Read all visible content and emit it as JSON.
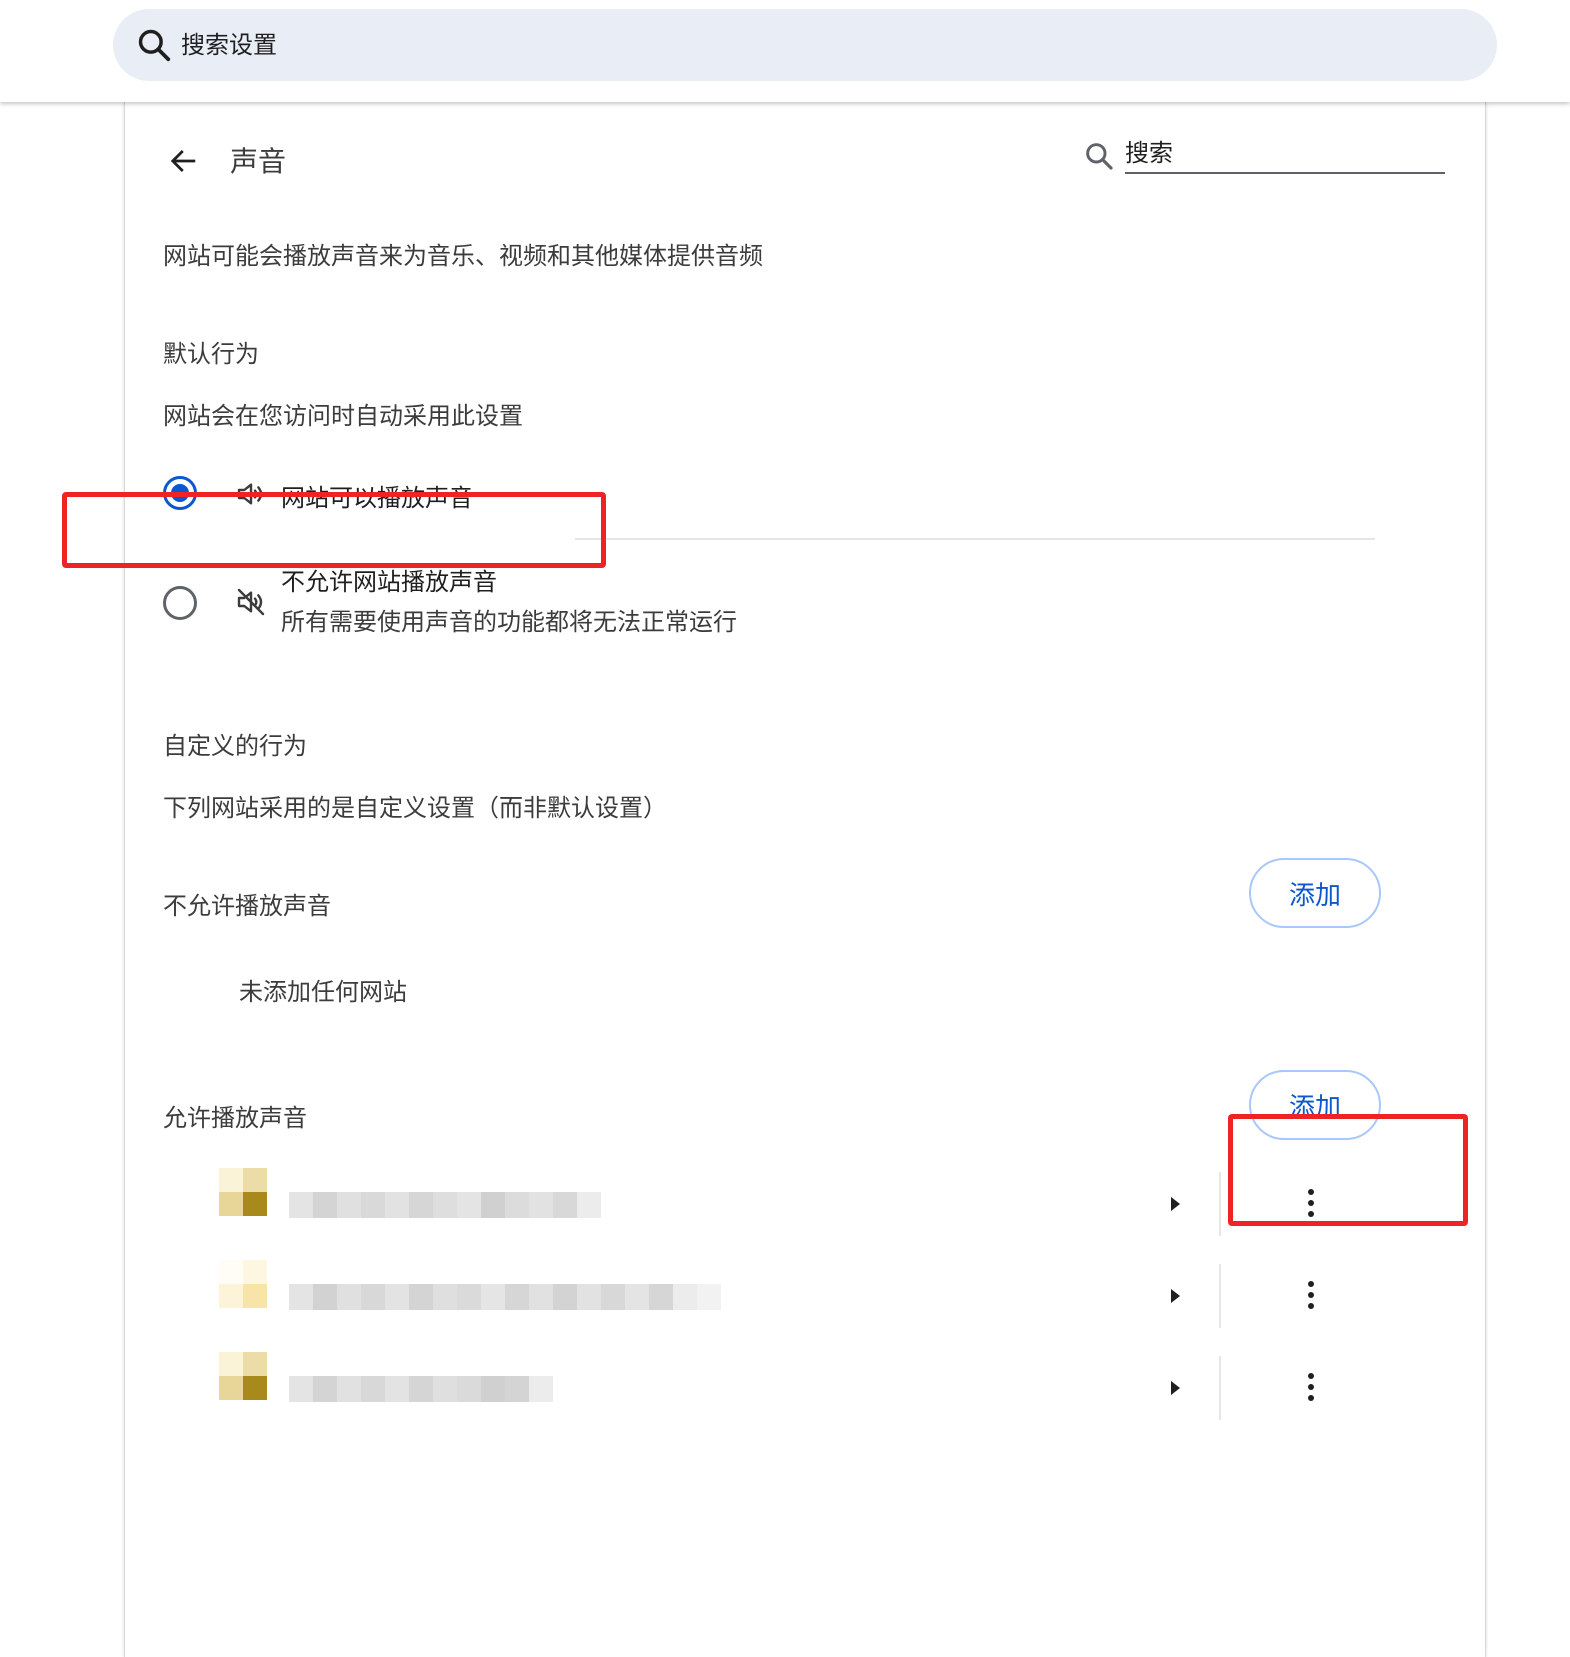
{
  "global_search": {
    "placeholder": "搜索设置",
    "icon": "search-icon"
  },
  "header": {
    "title": "声音",
    "back_icon": "arrow-left-icon",
    "search_placeholder": "搜索"
  },
  "description": "网站可能会播放声音来为音乐、视频和其他媒体提供音频",
  "default_behavior": {
    "heading": "默认行为",
    "subheading": "网站会在您访问时自动采用此设置",
    "options": [
      {
        "label": "网站可以播放声音",
        "icon": "volume-up-icon",
        "selected": true
      },
      {
        "label": "不允许网站播放声音",
        "sublabel": "所有需要使用声音的功能都将无法正常运行",
        "icon": "volume-off-icon",
        "selected": false
      }
    ]
  },
  "custom_behavior": {
    "heading": "自定义的行为",
    "subheading": "下列网站采用的是自定义设置（而非默认设置）",
    "blocked": {
      "title": "不允许播放声音",
      "add_label": "添加",
      "empty_text": "未添加任何网站"
    },
    "allowed": {
      "title": "允许播放声音",
      "add_label": "添加",
      "site_count": 3
    }
  },
  "colors": {
    "accent": "#0b57d0",
    "highlight": "#ee2424",
    "search_bg": "#e9eef6"
  }
}
